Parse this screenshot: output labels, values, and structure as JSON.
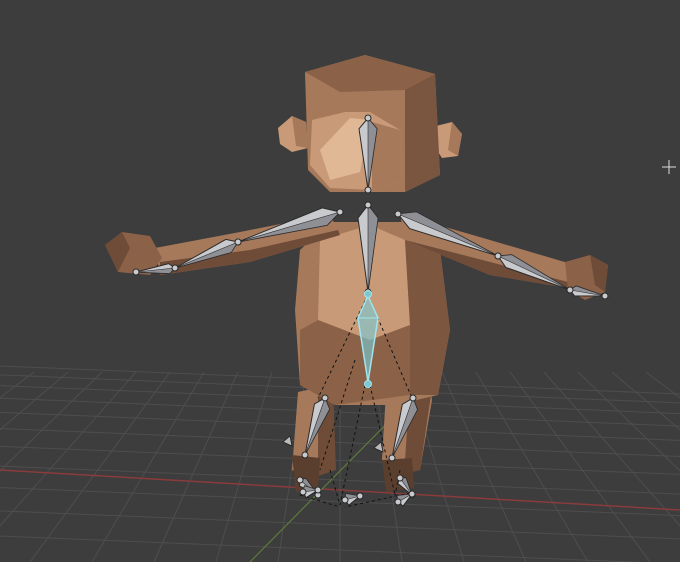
{
  "viewport": {
    "background": "#3d3d3d",
    "grid_color": "#4e4e4e",
    "x_axis_color": "#8a3b3b",
    "y_axis_color": "#5f7a3d"
  },
  "character": {
    "skin_light": "#c99a78",
    "skin_mid": "#a6795b",
    "skin_dark": "#6f4c38",
    "hair": "#7a5641"
  },
  "armature": {
    "bone_color": "#c9cacd",
    "bone_edge": "#2a2a2a",
    "selected_bone_color": "#7ec7cf",
    "selected_bone_outline": "#9ee6f0",
    "ik_line_color": "#111111"
  },
  "cursor_icon": "3d-cursor-crosshair-icon"
}
